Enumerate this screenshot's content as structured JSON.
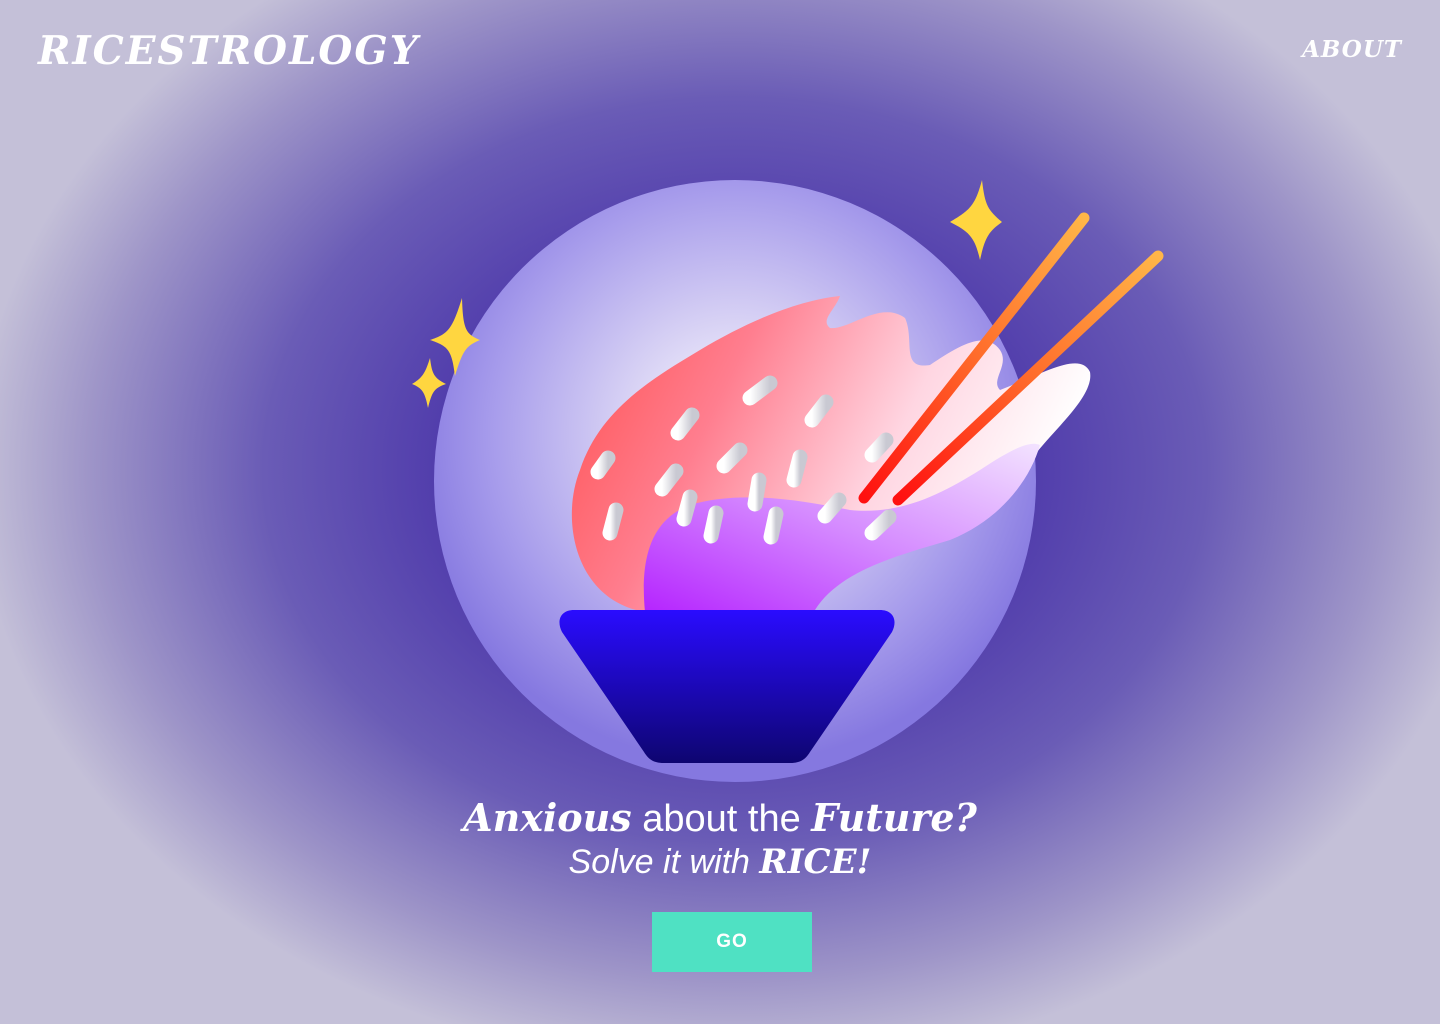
{
  "header": {
    "brand": "RICESTROLOGY",
    "nav_about": "ABOUT"
  },
  "hero": {
    "headline_part1": "Anxious",
    "headline_part2": " about the ",
    "headline_part3": "Future?",
    "subline_part1": "Solve it with ",
    "subline_part2": "RICE!",
    "cta_label": "GO"
  },
  "icons": {
    "sparkles": "sparkle-icon",
    "illustration": "rice-bowl-with-chopsticks"
  },
  "colors": {
    "background": "#4a34a8",
    "cta": "#4fe1c3",
    "bowl": "#1e0be0",
    "sparkle": "#ffd640",
    "chopsticks": "#ff6a1f"
  }
}
